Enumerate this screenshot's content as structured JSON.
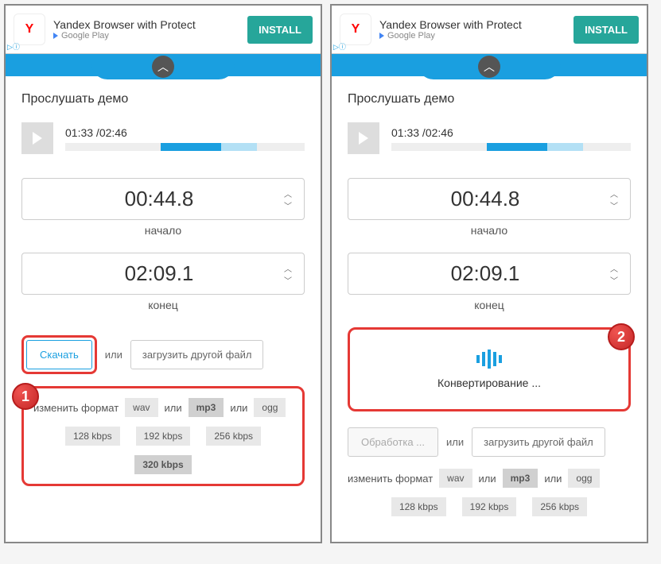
{
  "ad": {
    "title": "Yandex Browser with Protect",
    "store": "Google Play",
    "install": "INSTALL",
    "logo": "Y"
  },
  "demo": {
    "title": "Прослушать демо",
    "time": "01:33 /02:46"
  },
  "start": {
    "value": "00:44.8",
    "label": "начало"
  },
  "end": {
    "value": "02:09.1",
    "label": "конец"
  },
  "actions": {
    "download": "Скачать",
    "processing": "Обработка ...",
    "or": "или",
    "other_file": "загрузить другой файл"
  },
  "formats": {
    "label": "изменить формат",
    "wav": "wav",
    "mp3": "mp3",
    "ogg": "ogg",
    "or": "или"
  },
  "bitrates": {
    "b128": "128 kbps",
    "b192": "192 kbps",
    "b256": "256 kbps",
    "b320": "320 kbps"
  },
  "convert": {
    "text": "Конвертирование ..."
  },
  "badges": {
    "one": "1",
    "two": "2"
  }
}
